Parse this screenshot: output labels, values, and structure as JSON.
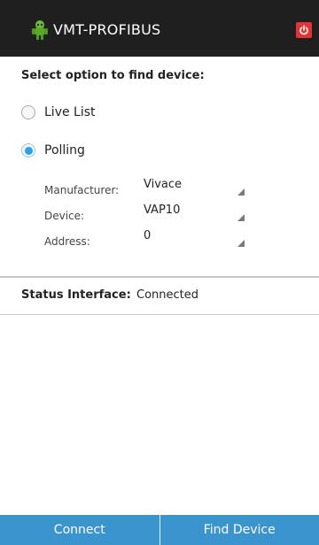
{
  "app": {
    "title": "VMT-PROFIBUS",
    "logo_icon": "robot-logo-icon",
    "power_icon": "power-icon",
    "accent_color": "#3a95ce",
    "power_color": "#e63232",
    "header_color": "#1f1f1f"
  },
  "find": {
    "prompt": "Select option to find device:",
    "options": [
      {
        "label": "Live List",
        "selected": false
      },
      {
        "label": "Polling",
        "selected": true
      }
    ]
  },
  "polling": {
    "fields": [
      {
        "label": "Manufacturer:",
        "value": "Vivace"
      },
      {
        "label": "Device:",
        "value": "VAP10"
      },
      {
        "label": "Address:",
        "value": "0"
      }
    ]
  },
  "status": {
    "label": "Status Interface:",
    "value": "Connected"
  },
  "actions": {
    "connect": "Connect",
    "find_device": "Find Device"
  }
}
